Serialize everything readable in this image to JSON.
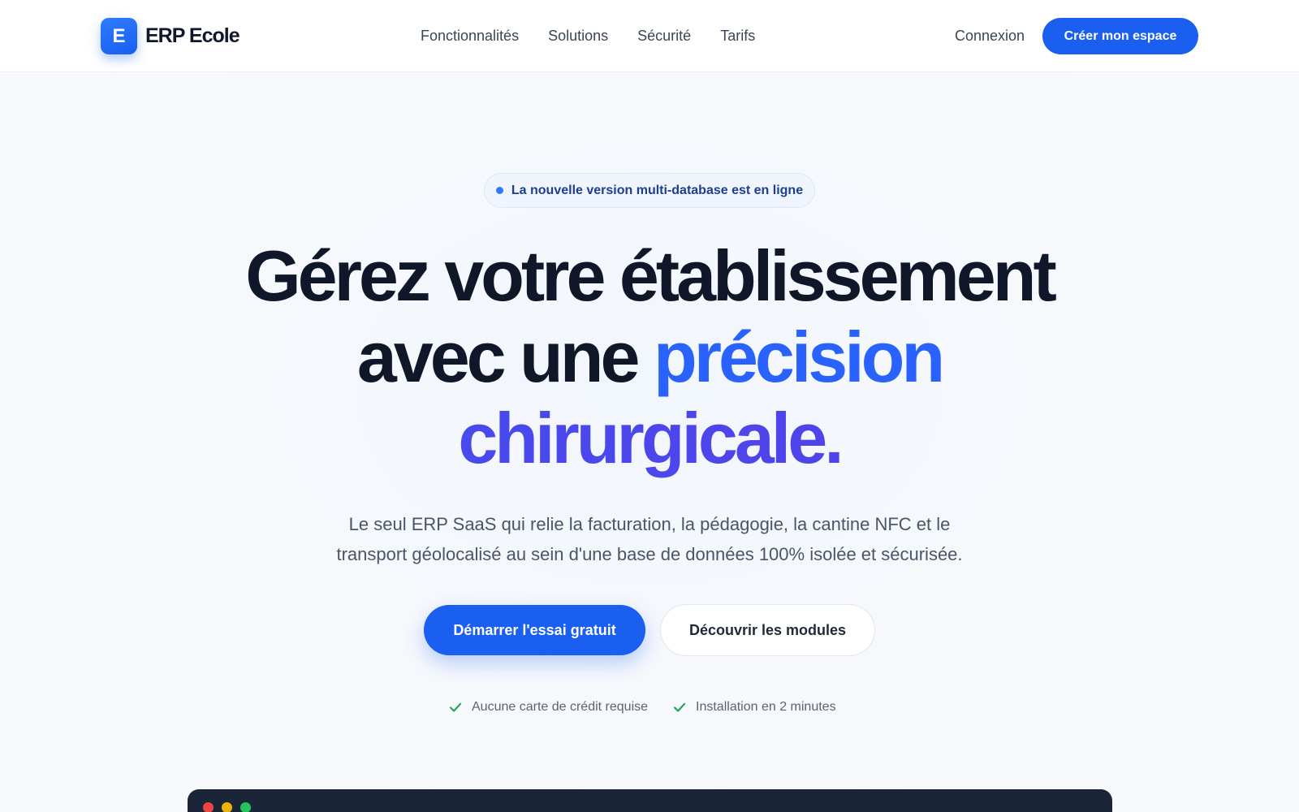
{
  "brand": {
    "logo_letter": "E",
    "name": "ERP Ecole"
  },
  "nav": {
    "links": [
      "Fonctionnalités",
      "Solutions",
      "Sécurité",
      "Tarifs"
    ],
    "login": "Connexion",
    "cta": "Créer mon espace"
  },
  "hero": {
    "badge": "La nouvelle version multi-database est en ligne",
    "headline_line1": "Gérez votre établissement",
    "headline_line2_plain": "avec une ",
    "headline_line2_accent": "précision",
    "headline_line3_accent": "chirurgicale.",
    "subtitle_line1": "Le seul ERP SaaS qui relie la facturation, la pédagogie, la cantine NFC et le",
    "subtitle_line2": "transport géolocalisé au sein d'une base de données 100% isolée et sécurisée.",
    "primary_button": "Démarrer l'essai gratuit",
    "secondary_button": "Découvrir les modules",
    "checks": [
      "Aucune carte de crédit requise",
      "Installation en 2 minutes"
    ]
  },
  "colors": {
    "primary": "#1a5ff0",
    "accent_blue": "#2962ff",
    "accent_violet": "#4b3cec",
    "heading": "#0f1729",
    "check_green": "#22a55a",
    "preview_bg": "#1b2538"
  },
  "icons": {
    "badge": "status-dot-icon",
    "check": "check-icon",
    "window_controls": [
      "close-dot-icon",
      "minimize-dot-icon",
      "maximize-dot-icon"
    ]
  }
}
